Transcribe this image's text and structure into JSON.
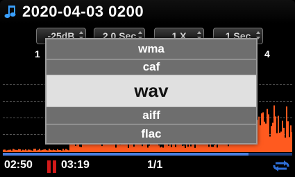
{
  "header": {
    "title": "2020-04-03 0200",
    "icon": "music-note-icon"
  },
  "controls": {
    "volume": "-25dB",
    "interval": "2.0 Sec",
    "speed": "1 X",
    "step": "1 Sec"
  },
  "markers": [
    "1",
    "4"
  ],
  "format_menu": {
    "options": [
      "wma",
      "caf",
      "wav",
      "aiff",
      "flac"
    ],
    "selected": "wav"
  },
  "status": {
    "elapsed": "02:50",
    "total": "03:19",
    "track": "1/1",
    "progress": 0.85,
    "pause_color": "#d21a1a",
    "repeat_icon": "repeat-icon"
  },
  "colors": {
    "waveform": "#ff5a1f",
    "accent_blue": "#4a7ee0"
  }
}
